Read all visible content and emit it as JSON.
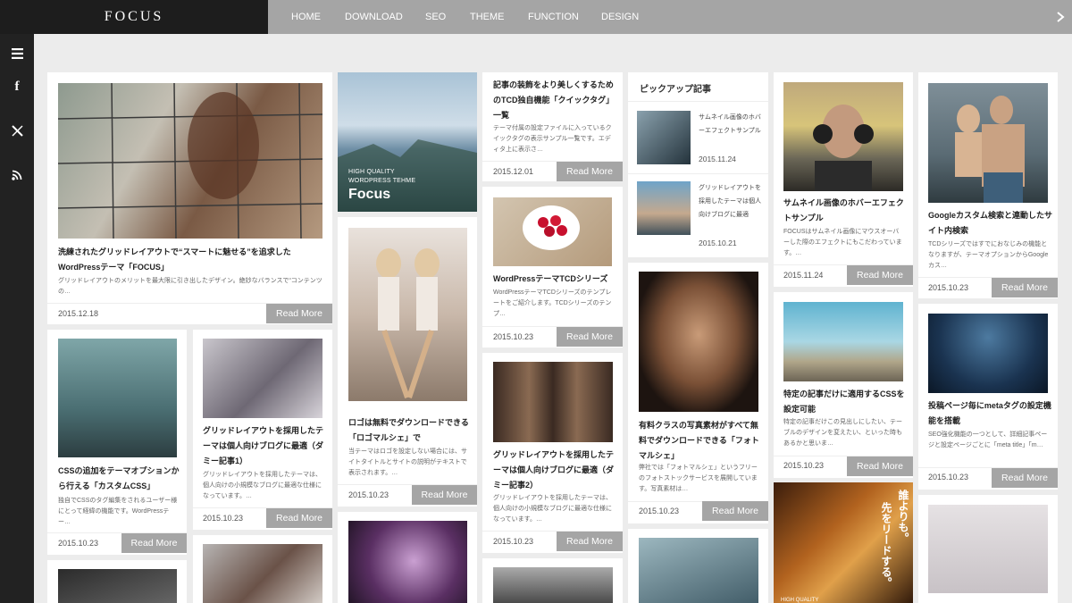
{
  "site": {
    "logo": "FOCUS"
  },
  "nav": {
    "items": [
      "HOME",
      "DOWNLOAD",
      "SEO",
      "THEME",
      "FUNCTION",
      "DESIGN"
    ]
  },
  "sidebar": {
    "icons": [
      "menu-icon",
      "facebook-icon",
      "x-icon",
      "rss-icon"
    ],
    "facebook_glyph": "f"
  },
  "read_more": "Read More",
  "colors": {
    "accent": "#a5a5a5",
    "sidebar": "#222222",
    "logo_bg": "#1d1d1d",
    "page_bg": "#ececec"
  },
  "posts": {
    "p1": {
      "title": "洗練されたグリッドレイアウトで“スマートに魅せる”を追求したWordPressテーマ「FOCUS」",
      "excerpt": "グリッドレイアウトのメリットを最大限に引き出したデザイン。絶妙なバランスで“コンテンツの…",
      "date": "2015.12.18"
    },
    "p2": {
      "banner_line1": "HIGH QUALITY",
      "banner_line2": "WORDPRESS TEHME",
      "banner_title": "Focus"
    },
    "p3": {
      "title": "記事の装飾をより美しくするためのTCD独自機能「クイックタグ」一覧",
      "excerpt": "テーマ付属の設定ファイルに入っているクイックタグの表示サンプル一覧です。エディタ上に表示さ…",
      "date": "2015.12.01"
    },
    "p4": {
      "heading": "ピックアップ記事",
      "items": [
        {
          "title": "サムネイル画像のホバーエフェクトサンプル",
          "date": "2015.11.24"
        },
        {
          "title": "グリッドレイアウトを採用したテーマは個人向けブログに最適",
          "date": "2015.10.21"
        }
      ]
    },
    "p5": {
      "title": "サムネイル画像のホバーエフェクトサンプル",
      "excerpt": "FOCUSはサムネイル画像にマウスオーバーした際のエフェクトにもこだわっています。…",
      "date": "2015.11.24"
    },
    "p6": {
      "title": "Googleカスタム検索と連動したサイト内検索",
      "excerpt": "TCDシリーズではすでにおなじみの機能となりますが、テーマオプションからGoogleカス…",
      "date": "2015.10.23"
    },
    "p7": {
      "title": "CSSの追加をテーマオプションから行える「カスタムCSS」",
      "excerpt": "独自でCSSのタグ編集をされるユーザー様にとって経緯の機能です。WordPressテー…",
      "date": "2015.10.23"
    },
    "p8": {
      "title": "グリッドレイアウトを採用したテーマは個人向けブログに最適（ダミー記事1）",
      "excerpt": "グリッドレイアウトを採用したテーマは、個人向けの小規模なブログに最適な仕様になっています。…",
      "date": "2015.10.23"
    },
    "p9": {
      "title": "ロゴは無料でダウンロードできる「ロゴマルシェ」で",
      "excerpt": "当テーマはロゴを設定しない場合には、サイトタイトルとサイトの説明がテキストで表示されます。…",
      "date": "2015.10.23"
    },
    "p10": {
      "title": "WordPressテーマTCDシリーズ",
      "excerpt": "WordPressテーマTCDシリーズのテンプレートをご紹介します。TCDシリーズのテンプ…",
      "date": "2015.10.23"
    },
    "p11": {
      "title": "グリッドレイアウトを採用したテーマは個人向けブログに最適（ダミー記事2）",
      "excerpt": "グリッドレイアウトを採用したテーマは、個人向けの小規模なブログに最適な仕様になっています。…",
      "date": "2015.10.23"
    },
    "p12": {
      "title": "有料クラスの写真素材がすべて無料でダウンロードできる「フォトマルシェ」",
      "excerpt": "弊社では「フォトマルシェ」というフリーのフォトストックサービスを展開しています。写真素材は…",
      "date": "2015.10.23"
    },
    "p13": {
      "title": "特定の記事だけに適用するCSSを設定可能",
      "excerpt": "特定の記事だけこの見出しにしたい、テーブルのデザインを変えたい、といった時もあるかと思いま…",
      "date": "2015.10.23"
    },
    "p14": {
      "title": "投稿ページ毎にmetaタグの設定機能を搭載",
      "excerpt": "SEO強化機能の一つとして、詳細記事ページと設定ページごとに「meta title」「m…",
      "date": "2015.10.23"
    },
    "p15": {
      "overlay_text_1": "誰よりも。",
      "overlay_text_2": "先をリードする。",
      "overlay_label": "HIGH QUALITY"
    }
  }
}
